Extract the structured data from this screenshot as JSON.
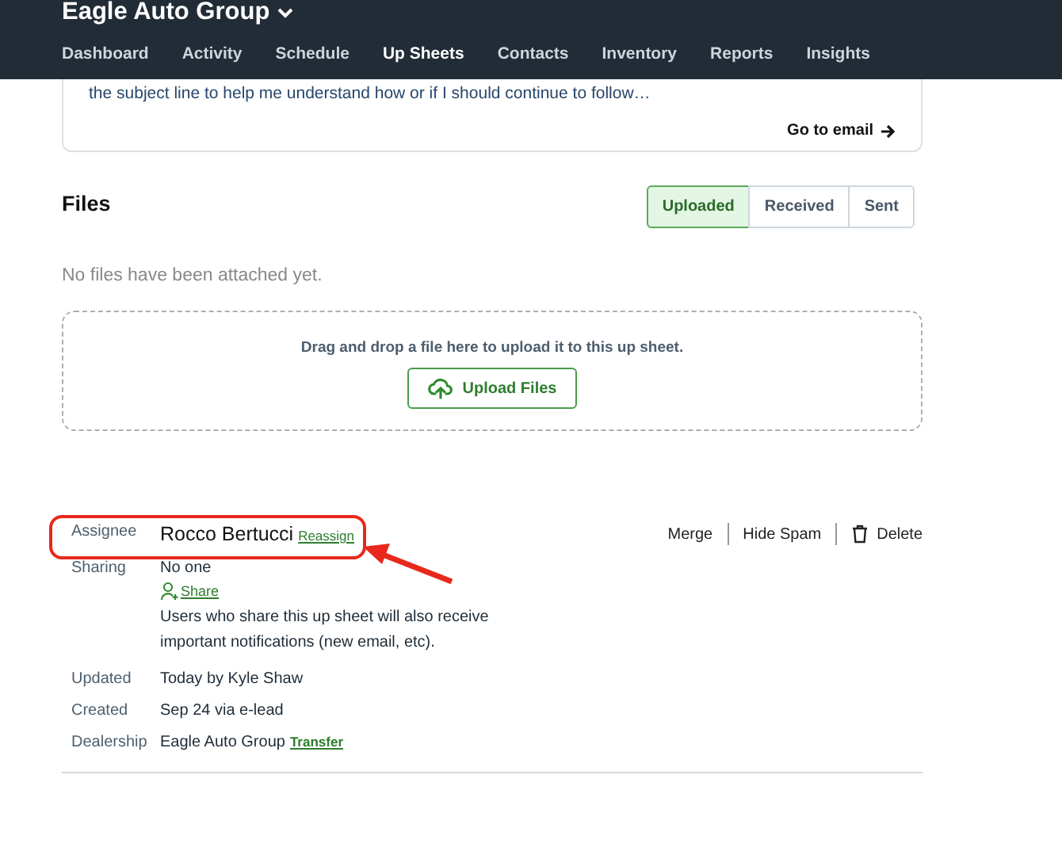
{
  "header": {
    "title": "Eagle Auto Group",
    "nav": [
      {
        "label": "Dashboard",
        "selected": false
      },
      {
        "label": "Activity",
        "selected": false
      },
      {
        "label": "Schedule",
        "selected": false
      },
      {
        "label": "Up Sheets",
        "selected": true
      },
      {
        "label": "Contacts",
        "selected": false
      },
      {
        "label": "Inventory",
        "selected": false
      },
      {
        "label": "Reports",
        "selected": false
      },
      {
        "label": "Insights",
        "selected": false
      }
    ]
  },
  "email_card": {
    "excerpt": "the subject line to help me understand how or if I should continue to follow…",
    "link": "Go to email"
  },
  "files": {
    "title": "Files",
    "tabs": [
      {
        "label": "Uploaded",
        "selected": true
      },
      {
        "label": "Received",
        "selected": false
      },
      {
        "label": "Sent",
        "selected": false
      }
    ],
    "empty_message": "No files have been attached yet.",
    "dropzone_text": "Drag and drop a file here to upload it to this up sheet.",
    "upload_button": "Upload Files"
  },
  "actions": [
    "Merge",
    "Hide Spam",
    "Delete"
  ],
  "details": [
    {
      "label": "Assignee",
      "kind": "assignee",
      "value": "Rocco Bertucci",
      "link": "Reassign"
    },
    {
      "label": "Sharing",
      "kind": "sharing",
      "value": "No one",
      "link": "Share",
      "note": "Users who share this up sheet will also receive important notifications (new email, etc)."
    },
    {
      "label": "Updated",
      "kind": "plain",
      "value": "Today by Kyle Shaw"
    },
    {
      "label": "Created",
      "kind": "plain",
      "value": "Sep 24 via e-lead"
    },
    {
      "label": "Dealership",
      "kind": "transfer",
      "value": "Eagle Auto Group",
      "link": "Transfer"
    }
  ]
}
